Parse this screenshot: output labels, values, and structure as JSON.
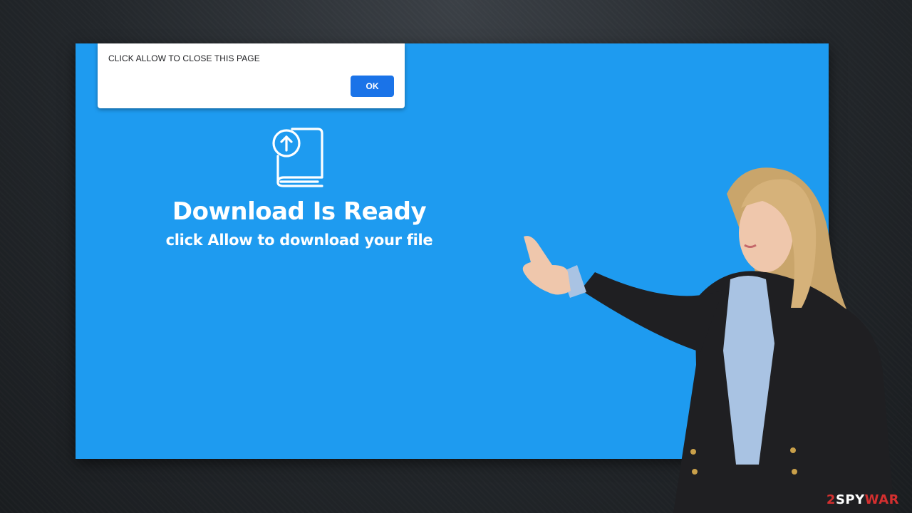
{
  "dialog": {
    "message": "CLICK ALLOW TO CLOSE THIS PAGE",
    "ok_label": "OK"
  },
  "hero": {
    "icon": "book-upload-icon",
    "title": "Download Is Ready",
    "subtitle": "click Allow to download your file"
  },
  "watermark": {
    "prefix": "2",
    "middle": "SPY",
    "suffix": "WAR"
  },
  "colors": {
    "page_background": "#1e9bf0",
    "ok_button": "#1a73e8",
    "text_light": "#ffffff",
    "watermark_accent": "#d32f2f"
  }
}
